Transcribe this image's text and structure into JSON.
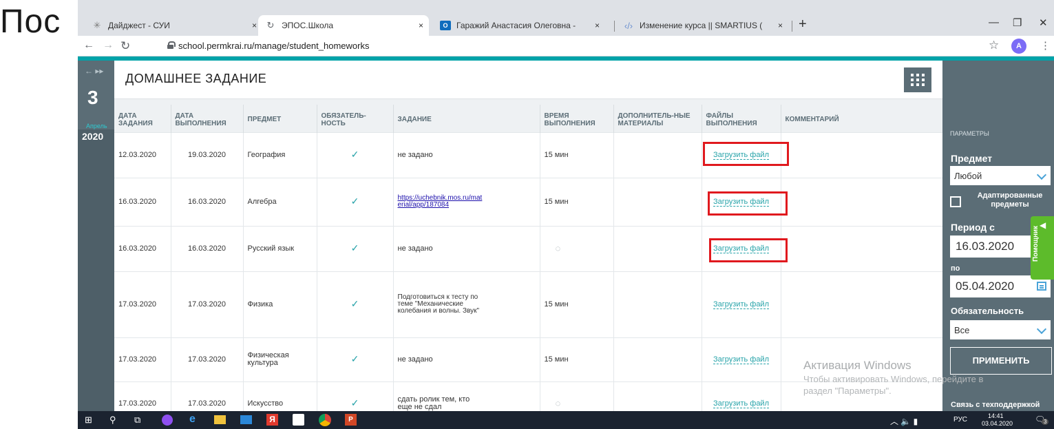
{
  "slide": {
    "text": "Пос"
  },
  "browser": {
    "tabs": [
      {
        "title": "Дайджест - СУИ",
        "icon": "sun-icon"
      },
      {
        "title": "ЭПОС.Школа",
        "icon": "refresh-icon"
      },
      {
        "title": "Гаражий Анастасия Олеговна -",
        "icon": "outlook-icon"
      },
      {
        "title": "Изменение курса || SMARTIUS (",
        "icon": "tag-icon"
      }
    ],
    "url": "school.permkrai.ru/manage/student_homeworks",
    "avatar_letter": "A",
    "close_glyph": "×",
    "new_tab_glyph": "+"
  },
  "date_panel": {
    "arrows": "← ▸▸",
    "day": "3",
    "month": "Апрель",
    "year": "2020"
  },
  "page": {
    "title": "ДОМАШНЕЕ ЗАДАНИЕ"
  },
  "table": {
    "headers": [
      "ДАТА ЗАДАНИЯ",
      "ДАТА ВЫПОЛНЕНИЯ",
      "ПРЕДМЕТ",
      "ОБЯЗАТЕЛЬ-НОСТЬ",
      "ЗАДАНИЕ",
      "ВРЕМЯ ВЫПОЛНЕНИЯ",
      "ДОПОЛНИТЕЛЬ-НЫЕ МАТЕРИАЛЫ",
      "ФАЙЛЫ ВЫПОЛНЕНИЯ",
      "КОММЕНТАРИЙ"
    ],
    "upload_label": "Загрузить файл",
    "rows": [
      {
        "given": "12.03.2020",
        "due": "19.03.2020",
        "subject": "География",
        "task": "не задано",
        "time": "15 мин"
      },
      {
        "given": "16.03.2020",
        "due": "16.03.2020",
        "subject": "Алгебра",
        "task": "https://uchebnik.mos.ru/material/app/187084",
        "time": "15 мин"
      },
      {
        "given": "16.03.2020",
        "due": "16.03.2020",
        "subject": "Русский язык",
        "task": "не задано",
        "time": ""
      },
      {
        "given": "17.03.2020",
        "due": "17.03.2020",
        "subject": "Физика",
        "task": "Подготовиться к тесту по теме \"Механические колебания и волны. Звук\"",
        "time": "15 мин"
      },
      {
        "given": "17.03.2020",
        "due": "17.03.2020",
        "subject": "Физическая культура",
        "task": "не задано",
        "time": "15 мин"
      },
      {
        "given": "17.03.2020",
        "due": "17.03.2020",
        "subject": "Искусство",
        "task": "сдать ролик тем, кто еще не сдал",
        "time": ""
      }
    ]
  },
  "sidebar": {
    "params_label": "ПАРАМЕТРЫ",
    "subject_label": "Предмет",
    "subject_value": "Любой",
    "adapted_label": "Адаптированные предметы",
    "period_from_label": "Период с",
    "period_from": "16.03.2020",
    "period_to_label": "по",
    "period_to": "05.04.2020",
    "mandatory_label": "Обязательность",
    "mandatory_value": "Все",
    "apply": "ПРИМЕНИТЬ",
    "support": "Связь с техподдержкой",
    "helper": "Помощник"
  },
  "watermark": {
    "title": "Активация Windows",
    "line1": "Чтобы активировать Windows, перейдите в",
    "line2": "раздел \"Параметры\"."
  },
  "taskbar": {
    "lang": "РУС",
    "time": "14:41",
    "date": "03.04.2020",
    "notifications": "3"
  }
}
